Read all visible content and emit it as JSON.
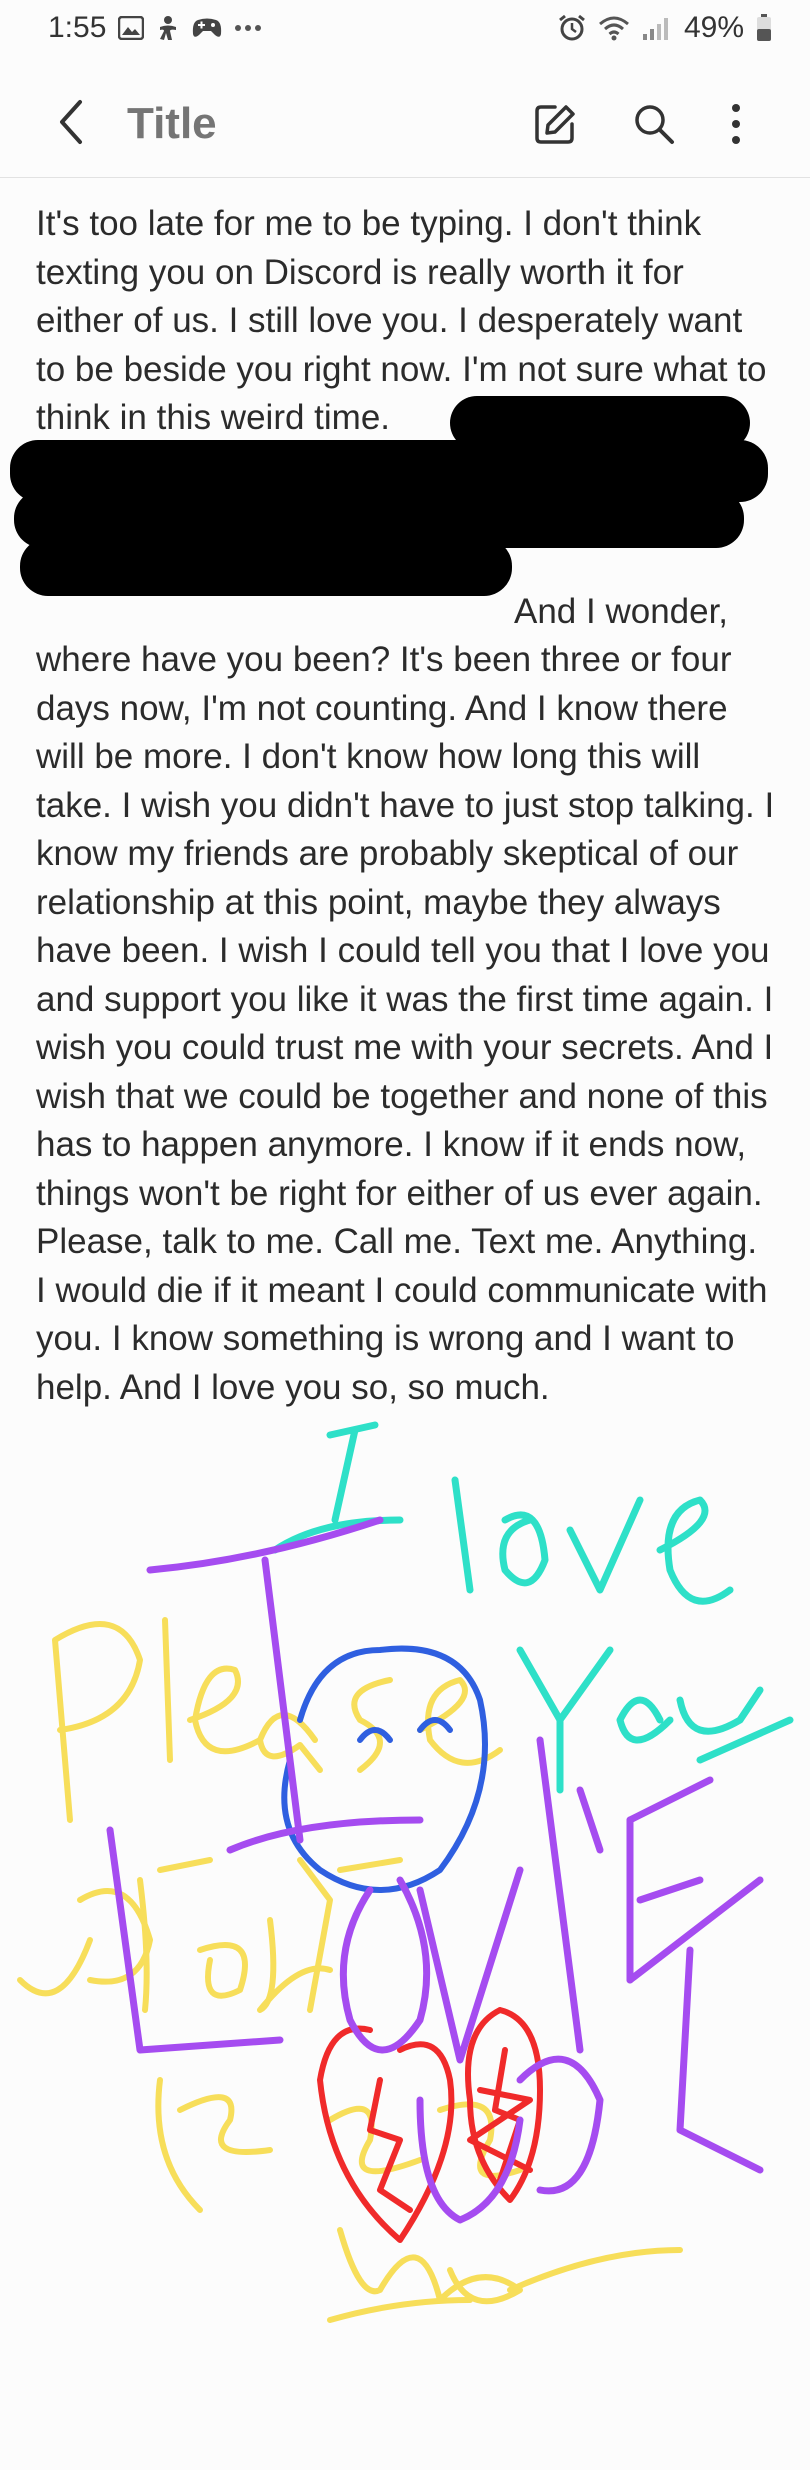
{
  "status_bar": {
    "time": "1:55",
    "left_icons": [
      "image-icon",
      "accessibility-icon",
      "game-controller-icon",
      "more-dots-icon"
    ],
    "right_icons": [
      "alarm-icon",
      "wifi-icon",
      "signal-icon",
      "battery-icon"
    ],
    "battery": "49%"
  },
  "toolbar": {
    "title_placeholder": "Title",
    "icons": [
      "back-chevron-icon",
      "edit-icon",
      "search-icon",
      "more-vert-icon"
    ]
  },
  "note": {
    "text_part1": "It's too late for me to be typing. I don't think texting you on Discord is really worth it for either of us. I still love you. I desperately want to be beside you right now. I'm not sure what to think in this weird time.",
    "text_part2": "And I wonder, where have you been? It's been three or four days now, I'm not counting. And I know there will be more. I don't know how long this will take. I wish you didn't have to just stop talking. I know my friends are probably skeptical of our relationship at this point, maybe they always have been. I wish I could tell you that I love you and support you like it was the first time again. I wish you could trust me with your secrets. And I wish that we could be together and none of this has to happen anymore. I know if it ends now, things won't be right for either of us ever again. Please, talk to me. Call me. Text me. Anything. I would die if it meant I could communicate with you. I know something is wrong and I want to help. And I love you so, so much."
  },
  "drawing": {
    "colors": {
      "teal": "#2ee0c8",
      "purple": "#a54cf0",
      "yellow": "#f7de5a",
      "blue": "#2f5fe0",
      "red": "#f02a2a"
    }
  }
}
